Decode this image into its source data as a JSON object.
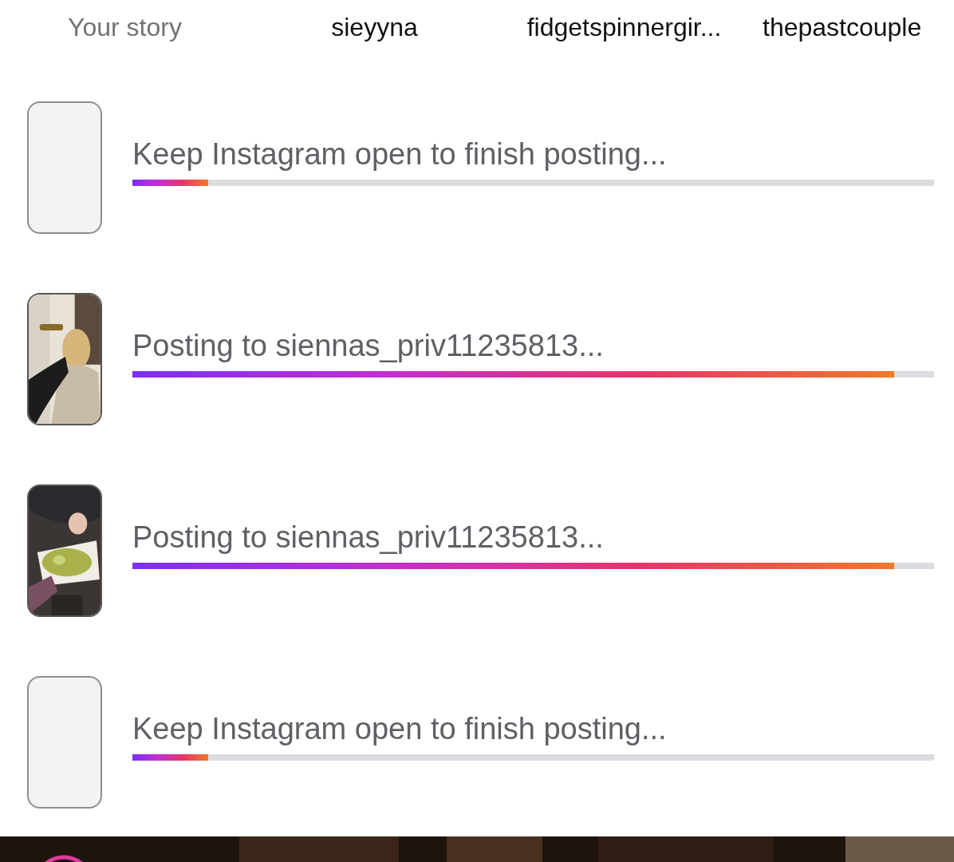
{
  "stories": [
    {
      "label": "Your story",
      "own": true
    },
    {
      "label": "sieyyna",
      "own": false
    },
    {
      "label": "fidgetspinnergir...",
      "own": false
    },
    {
      "label": "thepastcouple",
      "own": false
    }
  ],
  "uploads": [
    {
      "kind": "blank",
      "text": "Keep Instagram open to finish posting...",
      "level": 0.095
    },
    {
      "kind": "picture",
      "text": "Posting to siennas_priv11235813...",
      "level": 0.95
    },
    {
      "kind": "picture",
      "text": "Posting to siennas_priv11235813...",
      "level": 0.95
    },
    {
      "kind": "blank",
      "text": "Keep Instagram open to finish posting...",
      "level": 0.095
    }
  ]
}
